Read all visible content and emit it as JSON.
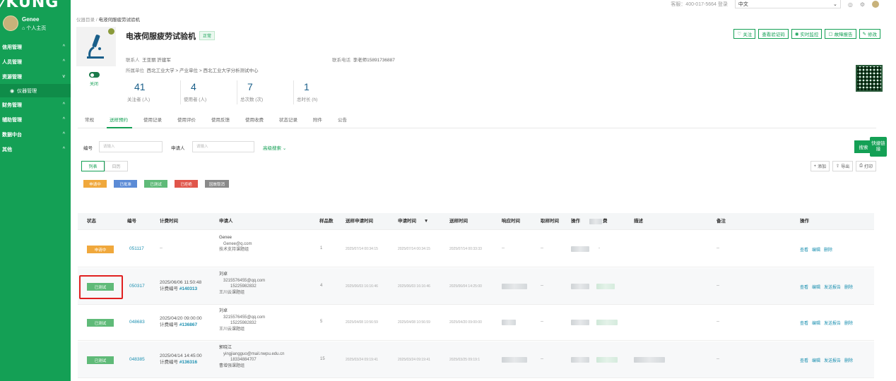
{
  "sidebar": {
    "logo": "KUNG",
    "user_name": "Genee",
    "home_link": "个人主页",
    "items": [
      {
        "label": "信用管理",
        "chev": "^"
      },
      {
        "label": "人员管理",
        "chev": "^"
      },
      {
        "label": "资源管理",
        "chev": "v"
      },
      {
        "label": "财务管理",
        "chev": "^"
      },
      {
        "label": "辅助管理",
        "chev": "^"
      },
      {
        "label": "数据中台",
        "chev": "^"
      },
      {
        "label": "其他",
        "chev": "^"
      }
    ],
    "sub_item": "仪器管理"
  },
  "topbar": {
    "phone": "客服：400-017-5664 登录",
    "language": "中文"
  },
  "breadcrumb": {
    "parent": "仪器目录",
    "sep": "/",
    "current": "电液伺服疲劳试验机"
  },
  "instrument": {
    "title": "电液伺服疲劳试验机",
    "status": "正常",
    "contact_label": "联系人",
    "contact_value": "王亚丽 許建军",
    "phone_label": "联系电话",
    "phone_value": "李老师15891736887",
    "unit_label": "所属单位",
    "unit_value": "西北工业大学 > 产业单位 > 西北工业大学分析测试中心",
    "toggle_label": "关闭"
  },
  "stats": [
    {
      "num": "41",
      "label": "关注者 (人)"
    },
    {
      "num": "4",
      "label": "使用者 (人)"
    },
    {
      "num": "7",
      "label": "总次数 (次)"
    },
    {
      "num": "1",
      "label": "总时长 (h)"
    }
  ],
  "actions": [
    "关注",
    "查看验证码",
    "实时监控",
    "故障报告",
    "修改"
  ],
  "tabs": [
    "常规",
    "送样预约",
    "使用记录",
    "使用评价",
    "使用反馈",
    "使用收费",
    "状态记录",
    "附件",
    "公告"
  ],
  "filters": {
    "code_label": "编号",
    "code_placeholder": "请输入",
    "applicant_label": "申请人",
    "applicant_placeholder": "请输入",
    "advanced": "高级搜索",
    "search_button": "搜索",
    "quick_link": "快捷链接"
  },
  "view_toggle": [
    "列表",
    "日历"
  ],
  "tools": [
    "添加",
    "导出",
    "打印"
  ],
  "legend": [
    {
      "label": "申请中",
      "color": "#f0a83c"
    },
    {
      "label": "已批准",
      "color": "#5b8bd6"
    },
    {
      "label": "已测试",
      "color": "#5fba78"
    },
    {
      "label": "已拒绝",
      "color": "#e0554a"
    },
    {
      "label": "因故取消",
      "color": "#8a8a8a"
    }
  ],
  "table": {
    "headers": [
      "状态",
      "编号",
      "计费时间",
      "申请人",
      "样品数",
      "送样申请时间",
      "申请时间",
      "送样时间",
      "响应时间",
      "取样时间",
      "操作",
      "费",
      "描述",
      "备注",
      "操作"
    ],
    "sort_icon": "▼",
    "rows": [
      {
        "status": "申请中",
        "status_color": "#f0a83c",
        "code": "051117",
        "fee_time": "--",
        "fee_no_label": "",
        "fee_no": "",
        "applicant_name": "Genee",
        "applicant_email": "Genee@q.com",
        "applicant_phone": "",
        "applicant_group": "技术支持课题组",
        "samples": "1",
        "t1": "2025/07/14 00:34:15",
        "t2": "2025/07/14 00:34:15",
        "t3": "2025/07/14 00:33:33",
        "resp": "--",
        "take": "--",
        "desc": "",
        "note": "--",
        "ops": [
          "查看",
          "编辑",
          "删除"
        ]
      },
      {
        "status": "已测试",
        "status_color": "#5fba78",
        "code": "050317",
        "fee_time": "2025/06/06 11:50:48",
        "fee_no_label": "计费编号",
        "fee_no": "#140313",
        "applicant_name": "刘卓",
        "applicant_email": "3215576455@qq.com",
        "applicant_phone": "15225982832",
        "applicant_group": "王川云课题组",
        "samples": "4",
        "t1": "2025/06/03 16:16:46",
        "t2": "2025/06/03 16:16:46",
        "t3": "2025/06/04 14:25:00",
        "resp": "",
        "take": "--",
        "desc": "",
        "note": "--",
        "ops": [
          "查看",
          "编辑",
          "发送报告",
          "删除"
        ]
      },
      {
        "status": "已测试",
        "status_color": "#5fba78",
        "code": "048683",
        "fee_time": "2025/04/20 09:00:00",
        "fee_no_label": "计费编号",
        "fee_no": "#136867",
        "applicant_name": "刘卓",
        "applicant_email": "3215576455@qq.com",
        "applicant_phone": "15225982832",
        "applicant_group": "王川云课题组",
        "samples": "5",
        "t1": "2025/04/08 10:56:59",
        "t2": "2025/04/08 10:56:59",
        "t3": "2025/04/20 09:00:00",
        "resp": "",
        "take": "--",
        "desc": "",
        "note": "--",
        "ops": [
          "查看",
          "编辑",
          "发送报告",
          "删除"
        ]
      },
      {
        "status": "已测试",
        "status_color": "#5fba78",
        "code": "048385",
        "fee_time": "2025/04/14 14:45:00",
        "fee_no_label": "计费编号",
        "fee_no": "#136316",
        "applicant_name": "郭晓江",
        "applicant_email": "yingjiangguo@mail.nwpu.edu.cn",
        "applicant_phone": "18334884707",
        "applicant_group": "曹增强课题组",
        "samples": "15",
        "t1": "2025/03/24 09:19:41",
        "t2": "2025/03/24 09:19:41",
        "t3": "2025/03/25 09:19:1",
        "resp": "",
        "take": "--",
        "desc": "",
        "note": "--",
        "ops": [
          "查看",
          "编辑",
          "发送报告",
          "删除"
        ]
      }
    ]
  }
}
